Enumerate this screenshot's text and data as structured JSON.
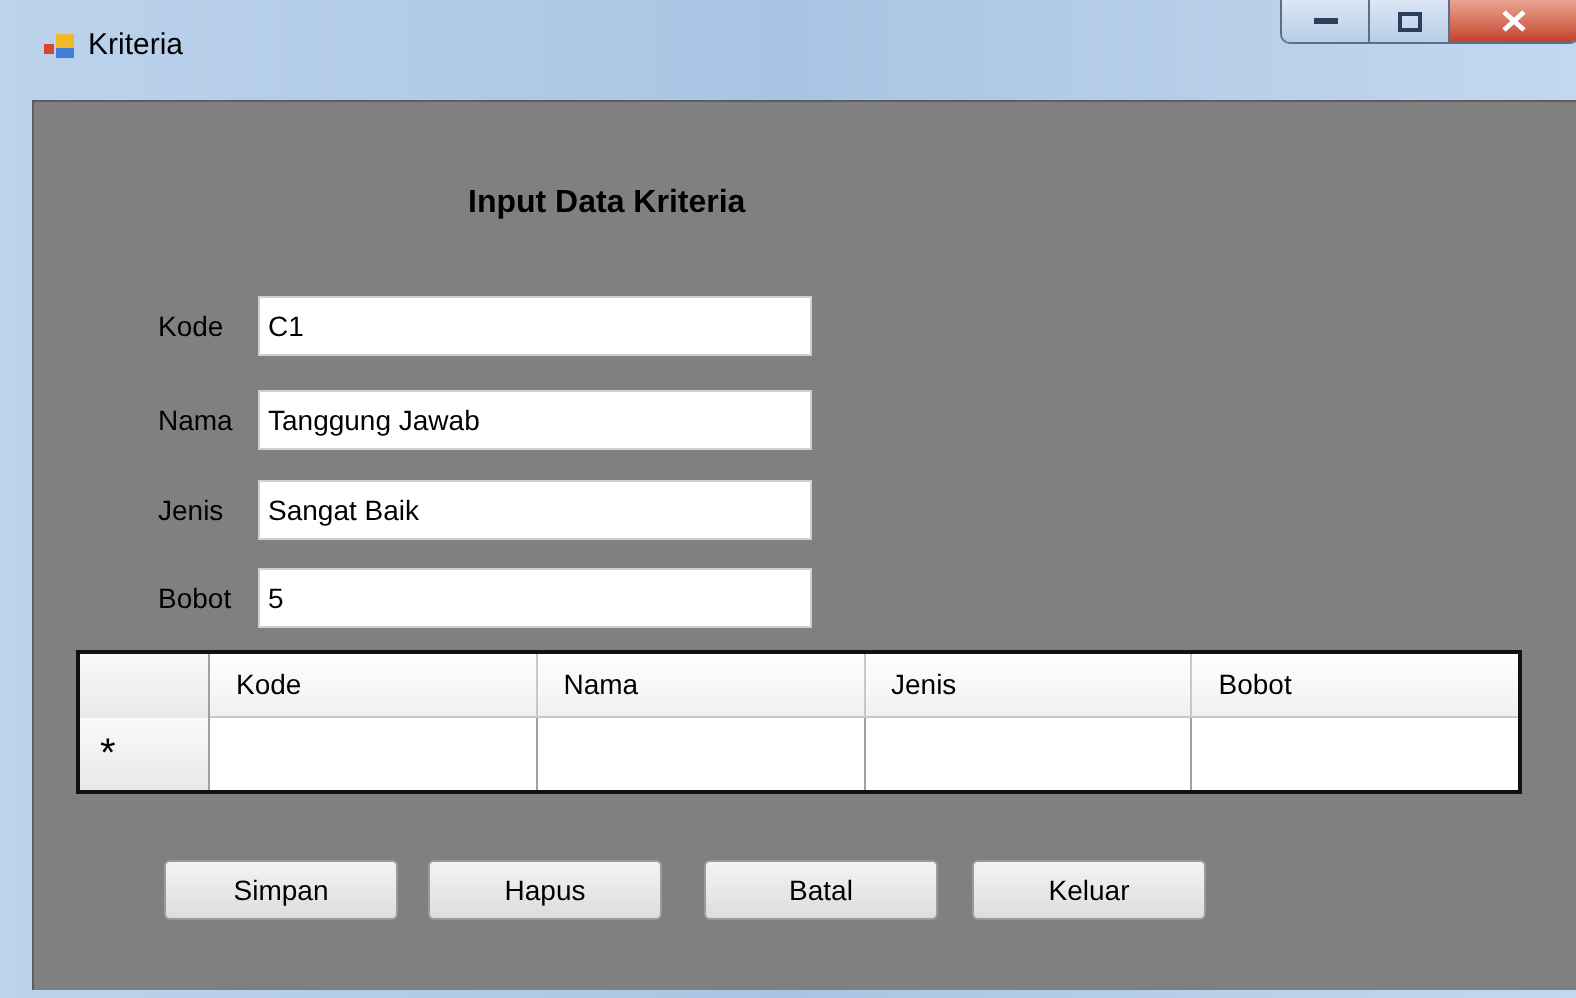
{
  "window": {
    "title": "Kriteria"
  },
  "heading": "Input Data Kriteria",
  "fields": [
    {
      "label": "Kode",
      "value": "C1"
    },
    {
      "label": "Nama",
      "value": "Tanggung Jawab"
    },
    {
      "label": "Jenis",
      "value": "Sangat Baik"
    },
    {
      "label": "Bobot",
      "value": "5"
    }
  ],
  "table": {
    "columns": [
      "Kode",
      "Nama",
      "Jenis",
      "Bobot"
    ],
    "new_row_marker": "*"
  },
  "buttons": [
    "Simpan",
    "Hapus",
    "Batal",
    "Keluar"
  ]
}
